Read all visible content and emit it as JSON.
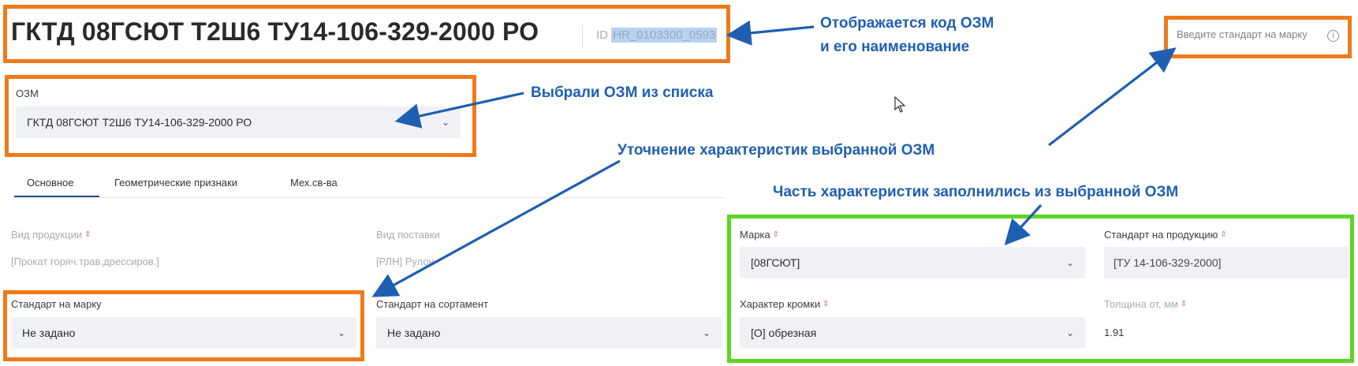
{
  "header": {
    "title": "ГКТД 08ГСЮТ Т2Ш6 ТУ14-106-329-2000 РО",
    "id_label": "ID",
    "id_value": "HR_0103300_0593",
    "hint_field": "Введите стандарт на марку",
    "info_icon": "info-icon"
  },
  "ozm": {
    "label": "ОЗМ",
    "value": "ГКТД 08ГСЮТ Т2Ш6 ТУ14-106-329-2000 РО"
  },
  "tabs": [
    {
      "label": "Основное",
      "active": true
    },
    {
      "label": "Геометрические признаки",
      "active": false
    },
    {
      "label": "Мех.св-ва",
      "active": false
    }
  ],
  "form": {
    "product_type": {
      "label": "Вид продукции",
      "value": "[Прокат горяч.трав.дрессиров.]"
    },
    "delivery_type": {
      "label": "Вид поставки",
      "value": "[РЛН] Рулон"
    },
    "grade": {
      "label": "Марка",
      "value": "[08ГСЮТ]"
    },
    "product_standard": {
      "label": "Стандарт на продукцию",
      "value": "[ТУ 14-106-329-2000]"
    },
    "grade_standard": {
      "label": "Стандарт на марку",
      "value": "Не задано"
    },
    "assortment_standard": {
      "label": "Стандарт на сортамент",
      "value": "Не задано"
    },
    "edge_type": {
      "label": "Характер кромки",
      "value": "[О] обрезная"
    },
    "thickness_from": {
      "label": "Толщина от, мм",
      "value": "1.91"
    }
  },
  "annotations": {
    "code_shown_1": "Отображается код ОЗМ",
    "code_shown_2": "и его наименование",
    "selected_from_list": "Выбрали ОЗМ из списка",
    "refine": "Уточнение характеристик выбранной ОЗМ",
    "autofilled": "Часть характеристик заполнились из выбранной ОЗМ"
  },
  "colors": {
    "annotation_text": "#1f5fb2",
    "arrow": "#1f5fb2",
    "frame_orange": "#f07a1a",
    "frame_green": "#5bd624",
    "required_marker": "#e27a7a"
  }
}
